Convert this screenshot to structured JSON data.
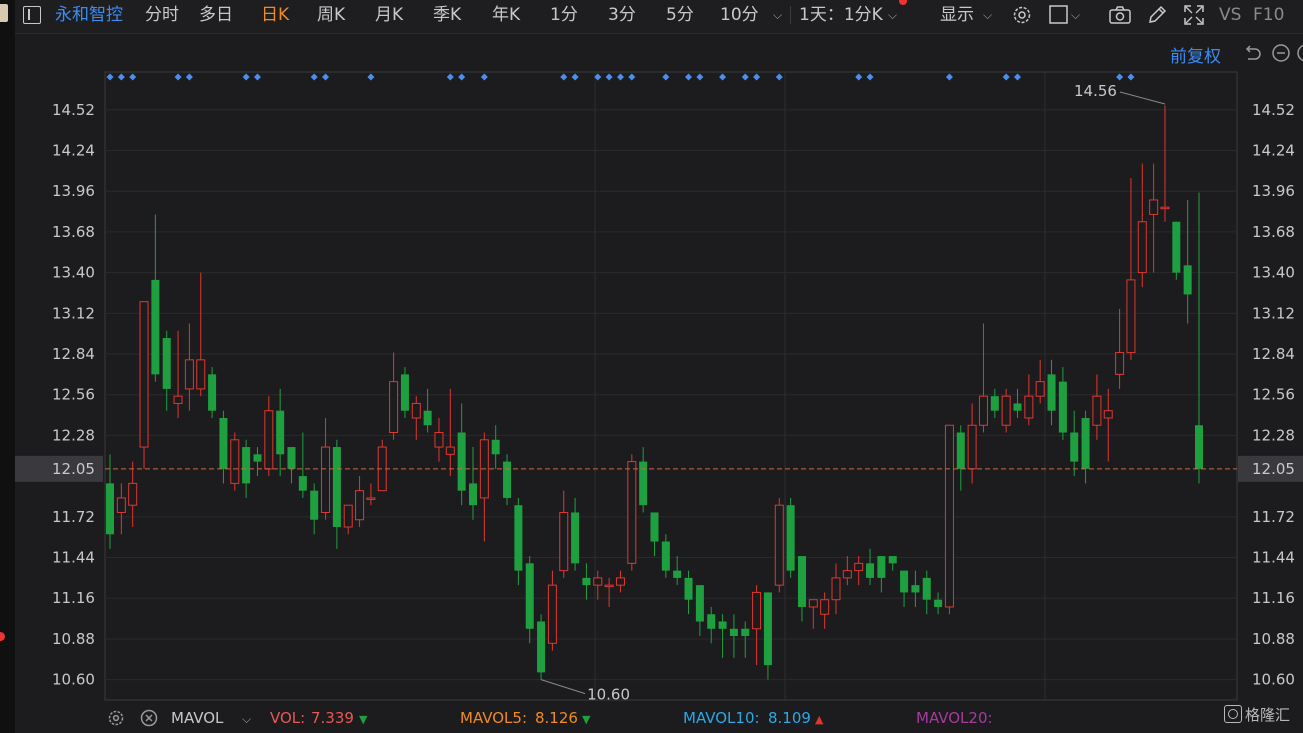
{
  "toolbar": {
    "stock_name": "永和智控",
    "periods": [
      "分时",
      "多日",
      "日K",
      "周K",
      "月K",
      "季K",
      "年K",
      "1分",
      "3分",
      "5分",
      "10分"
    ],
    "active_period": "日K",
    "interval_label": "1天：1分K",
    "display_label": "显示",
    "vs_label": "VS",
    "f10_label": "F10"
  },
  "subbar": {
    "adjust_label": "前复权"
  },
  "chart": {
    "current_price": "12.05",
    "high_label": "14.56",
    "low_label": "10.60"
  },
  "indicator": {
    "name": "MAVOL",
    "vol_label": "VOL:",
    "vol_value": "7.339",
    "mavol5_label": "MAVOL5:",
    "mavol5_value": "8.126",
    "mavol10_label": "MAVOL10:",
    "mavol10_value": "8.109",
    "mavol20_label": "MAVOL20:"
  },
  "brand": {
    "logo_text": "格隆汇"
  },
  "colors": {
    "up": "#e0362f",
    "down": "#1fa040",
    "stock_blue": "#3c8cf0",
    "active_orange": "#f08a24",
    "dashed_price": "#d0663c",
    "marker_blue": "#4a8ff0",
    "vol_red": "#e85858",
    "mavol5": "#f08a24",
    "mavol10": "#2aa8e8",
    "mavol20": "#a83a9e"
  },
  "chart_data": {
    "type": "candlestick",
    "y_ticks": [
      "14.52",
      "14.24",
      "13.96",
      "13.68",
      "13.40",
      "13.12",
      "12.84",
      "12.56",
      "12.28",
      "12.05",
      "11.72",
      "11.44",
      "11.16",
      "10.88",
      "10.60"
    ],
    "ylim": [
      10.46,
      14.78
    ],
    "current_price": 12.05,
    "high": 14.56,
    "low": 10.6,
    "candles": [
      [
        11.95,
        11.6,
        12.15,
        11.5
      ],
      [
        11.75,
        11.85,
        11.95,
        11.6
      ],
      [
        11.8,
        11.95,
        12.1,
        11.65
      ],
      [
        12.2,
        13.2,
        13.2,
        12.05
      ],
      [
        13.35,
        12.7,
        13.8,
        12.65
      ],
      [
        12.95,
        12.6,
        13.0,
        12.45
      ],
      [
        12.5,
        12.55,
        13.0,
        12.4
      ],
      [
        12.6,
        12.8,
        13.05,
        12.45
      ],
      [
        12.6,
        12.8,
        13.4,
        12.55
      ],
      [
        12.7,
        12.45,
        12.75,
        12.4
      ],
      [
        12.4,
        12.05,
        12.45,
        11.95
      ],
      [
        11.95,
        12.25,
        12.3,
        11.9
      ],
      [
        12.2,
        11.95,
        12.25,
        11.85
      ],
      [
        12.15,
        12.1,
        12.2,
        12.0
      ],
      [
        12.05,
        12.45,
        12.55,
        12.0
      ],
      [
        12.45,
        12.15,
        12.6,
        12.0
      ],
      [
        12.2,
        12.05,
        12.2,
        11.95
      ],
      [
        12.0,
        11.9,
        12.3,
        11.85
      ],
      [
        11.9,
        11.7,
        11.95,
        11.6
      ],
      [
        11.75,
        12.2,
        12.4,
        11.7
      ],
      [
        12.2,
        11.65,
        12.25,
        11.5
      ],
      [
        11.65,
        11.8,
        11.8,
        11.6
      ],
      [
        11.7,
        11.9,
        12.0,
        11.65
      ],
      [
        11.85,
        11.85,
        11.95,
        11.8
      ],
      [
        11.9,
        12.2,
        12.25,
        11.9
      ],
      [
        12.3,
        12.65,
        12.85,
        12.25
      ],
      [
        12.7,
        12.45,
        12.75,
        12.4
      ],
      [
        12.4,
        12.5,
        12.55,
        12.25
      ],
      [
        12.45,
        12.35,
        12.6,
        12.3
      ],
      [
        12.2,
        12.3,
        12.4,
        12.1
      ],
      [
        12.15,
        12.2,
        12.6,
        12.0
      ],
      [
        12.3,
        11.9,
        12.5,
        11.8
      ],
      [
        11.95,
        11.8,
        12.2,
        11.7
      ],
      [
        11.85,
        12.25,
        12.3,
        11.55
      ],
      [
        12.25,
        12.15,
        12.35,
        12.05
      ],
      [
        12.1,
        11.85,
        12.15,
        11.8
      ],
      [
        11.8,
        11.35,
        11.85,
        11.25
      ],
      [
        11.4,
        10.95,
        11.45,
        10.85
      ],
      [
        11.0,
        10.65,
        11.05,
        10.6
      ],
      [
        10.85,
        11.25,
        11.35,
        10.8
      ],
      [
        11.35,
        11.75,
        11.9,
        11.3
      ],
      [
        11.75,
        11.4,
        11.85,
        11.35
      ],
      [
        11.3,
        11.25,
        11.4,
        11.15
      ],
      [
        11.25,
        11.3,
        11.35,
        11.15
      ],
      [
        11.25,
        11.25,
        11.3,
        11.1
      ],
      [
        11.25,
        11.3,
        11.35,
        11.2
      ],
      [
        11.4,
        12.1,
        12.15,
        11.35
      ],
      [
        12.1,
        11.8,
        12.2,
        11.75
      ],
      [
        11.75,
        11.55,
        11.75,
        11.45
      ],
      [
        11.55,
        11.35,
        11.6,
        11.3
      ],
      [
        11.35,
        11.3,
        11.45,
        11.25
      ],
      [
        11.3,
        11.15,
        11.35,
        11.05
      ],
      [
        11.25,
        11.0,
        11.25,
        10.9
      ],
      [
        11.05,
        10.95,
        11.1,
        10.85
      ],
      [
        11.0,
        10.95,
        11.05,
        10.75
      ],
      [
        10.95,
        10.9,
        11.05,
        10.75
      ],
      [
        10.95,
        10.9,
        11.0,
        10.75
      ],
      [
        10.95,
        11.2,
        11.25,
        10.7
      ],
      [
        11.2,
        10.7,
        11.2,
        10.6
      ],
      [
        11.25,
        11.8,
        11.85,
        11.2
      ],
      [
        11.8,
        11.35,
        11.85,
        11.3
      ],
      [
        11.45,
        11.1,
        11.45,
        11.0
      ],
      [
        11.1,
        11.15,
        11.15,
        10.95
      ],
      [
        11.05,
        11.15,
        11.2,
        10.95
      ],
      [
        11.15,
        11.3,
        11.4,
        11.05
      ],
      [
        11.3,
        11.35,
        11.45,
        11.25
      ],
      [
        11.35,
        11.4,
        11.45,
        11.25
      ],
      [
        11.4,
        11.3,
        11.5,
        11.25
      ],
      [
        11.45,
        11.3,
        11.45,
        11.2
      ],
      [
        11.45,
        11.4,
        11.45,
        11.35
      ],
      [
        11.35,
        11.2,
        11.35,
        11.1
      ],
      [
        11.25,
        11.2,
        11.35,
        11.1
      ],
      [
        11.3,
        11.15,
        11.35,
        11.05
      ],
      [
        11.15,
        11.1,
        11.2,
        11.05
      ],
      [
        11.1,
        12.35,
        12.35,
        11.05
      ],
      [
        12.3,
        12.05,
        12.35,
        11.9
      ],
      [
        12.05,
        12.35,
        12.5,
        11.95
      ],
      [
        12.35,
        12.55,
        13.05,
        12.3
      ],
      [
        12.55,
        12.45,
        12.6,
        12.4
      ],
      [
        12.35,
        12.55,
        12.6,
        12.3
      ],
      [
        12.5,
        12.45,
        12.6,
        12.4
      ],
      [
        12.4,
        12.55,
        12.7,
        12.35
      ],
      [
        12.55,
        12.65,
        12.8,
        12.5
      ],
      [
        12.7,
        12.45,
        12.8,
        12.35
      ],
      [
        12.65,
        12.3,
        12.75,
        12.25
      ],
      [
        12.3,
        12.1,
        12.45,
        12.0
      ],
      [
        12.4,
        12.05,
        12.45,
        11.95
      ],
      [
        12.35,
        12.55,
        12.7,
        12.25
      ],
      [
        12.4,
        12.45,
        12.6,
        12.1
      ],
      [
        12.7,
        12.85,
        13.15,
        12.6
      ],
      [
        12.85,
        13.35,
        14.05,
        12.8
      ],
      [
        13.4,
        13.75,
        14.15,
        13.3
      ],
      [
        13.8,
        13.9,
        14.15,
        13.4
      ],
      [
        13.85,
        13.85,
        14.55,
        13.75
      ],
      [
        13.75,
        13.4,
        13.75,
        13.35
      ],
      [
        13.45,
        13.25,
        13.9,
        13.05
      ],
      [
        12.35,
        12.05,
        13.95,
        11.95
      ]
    ]
  }
}
